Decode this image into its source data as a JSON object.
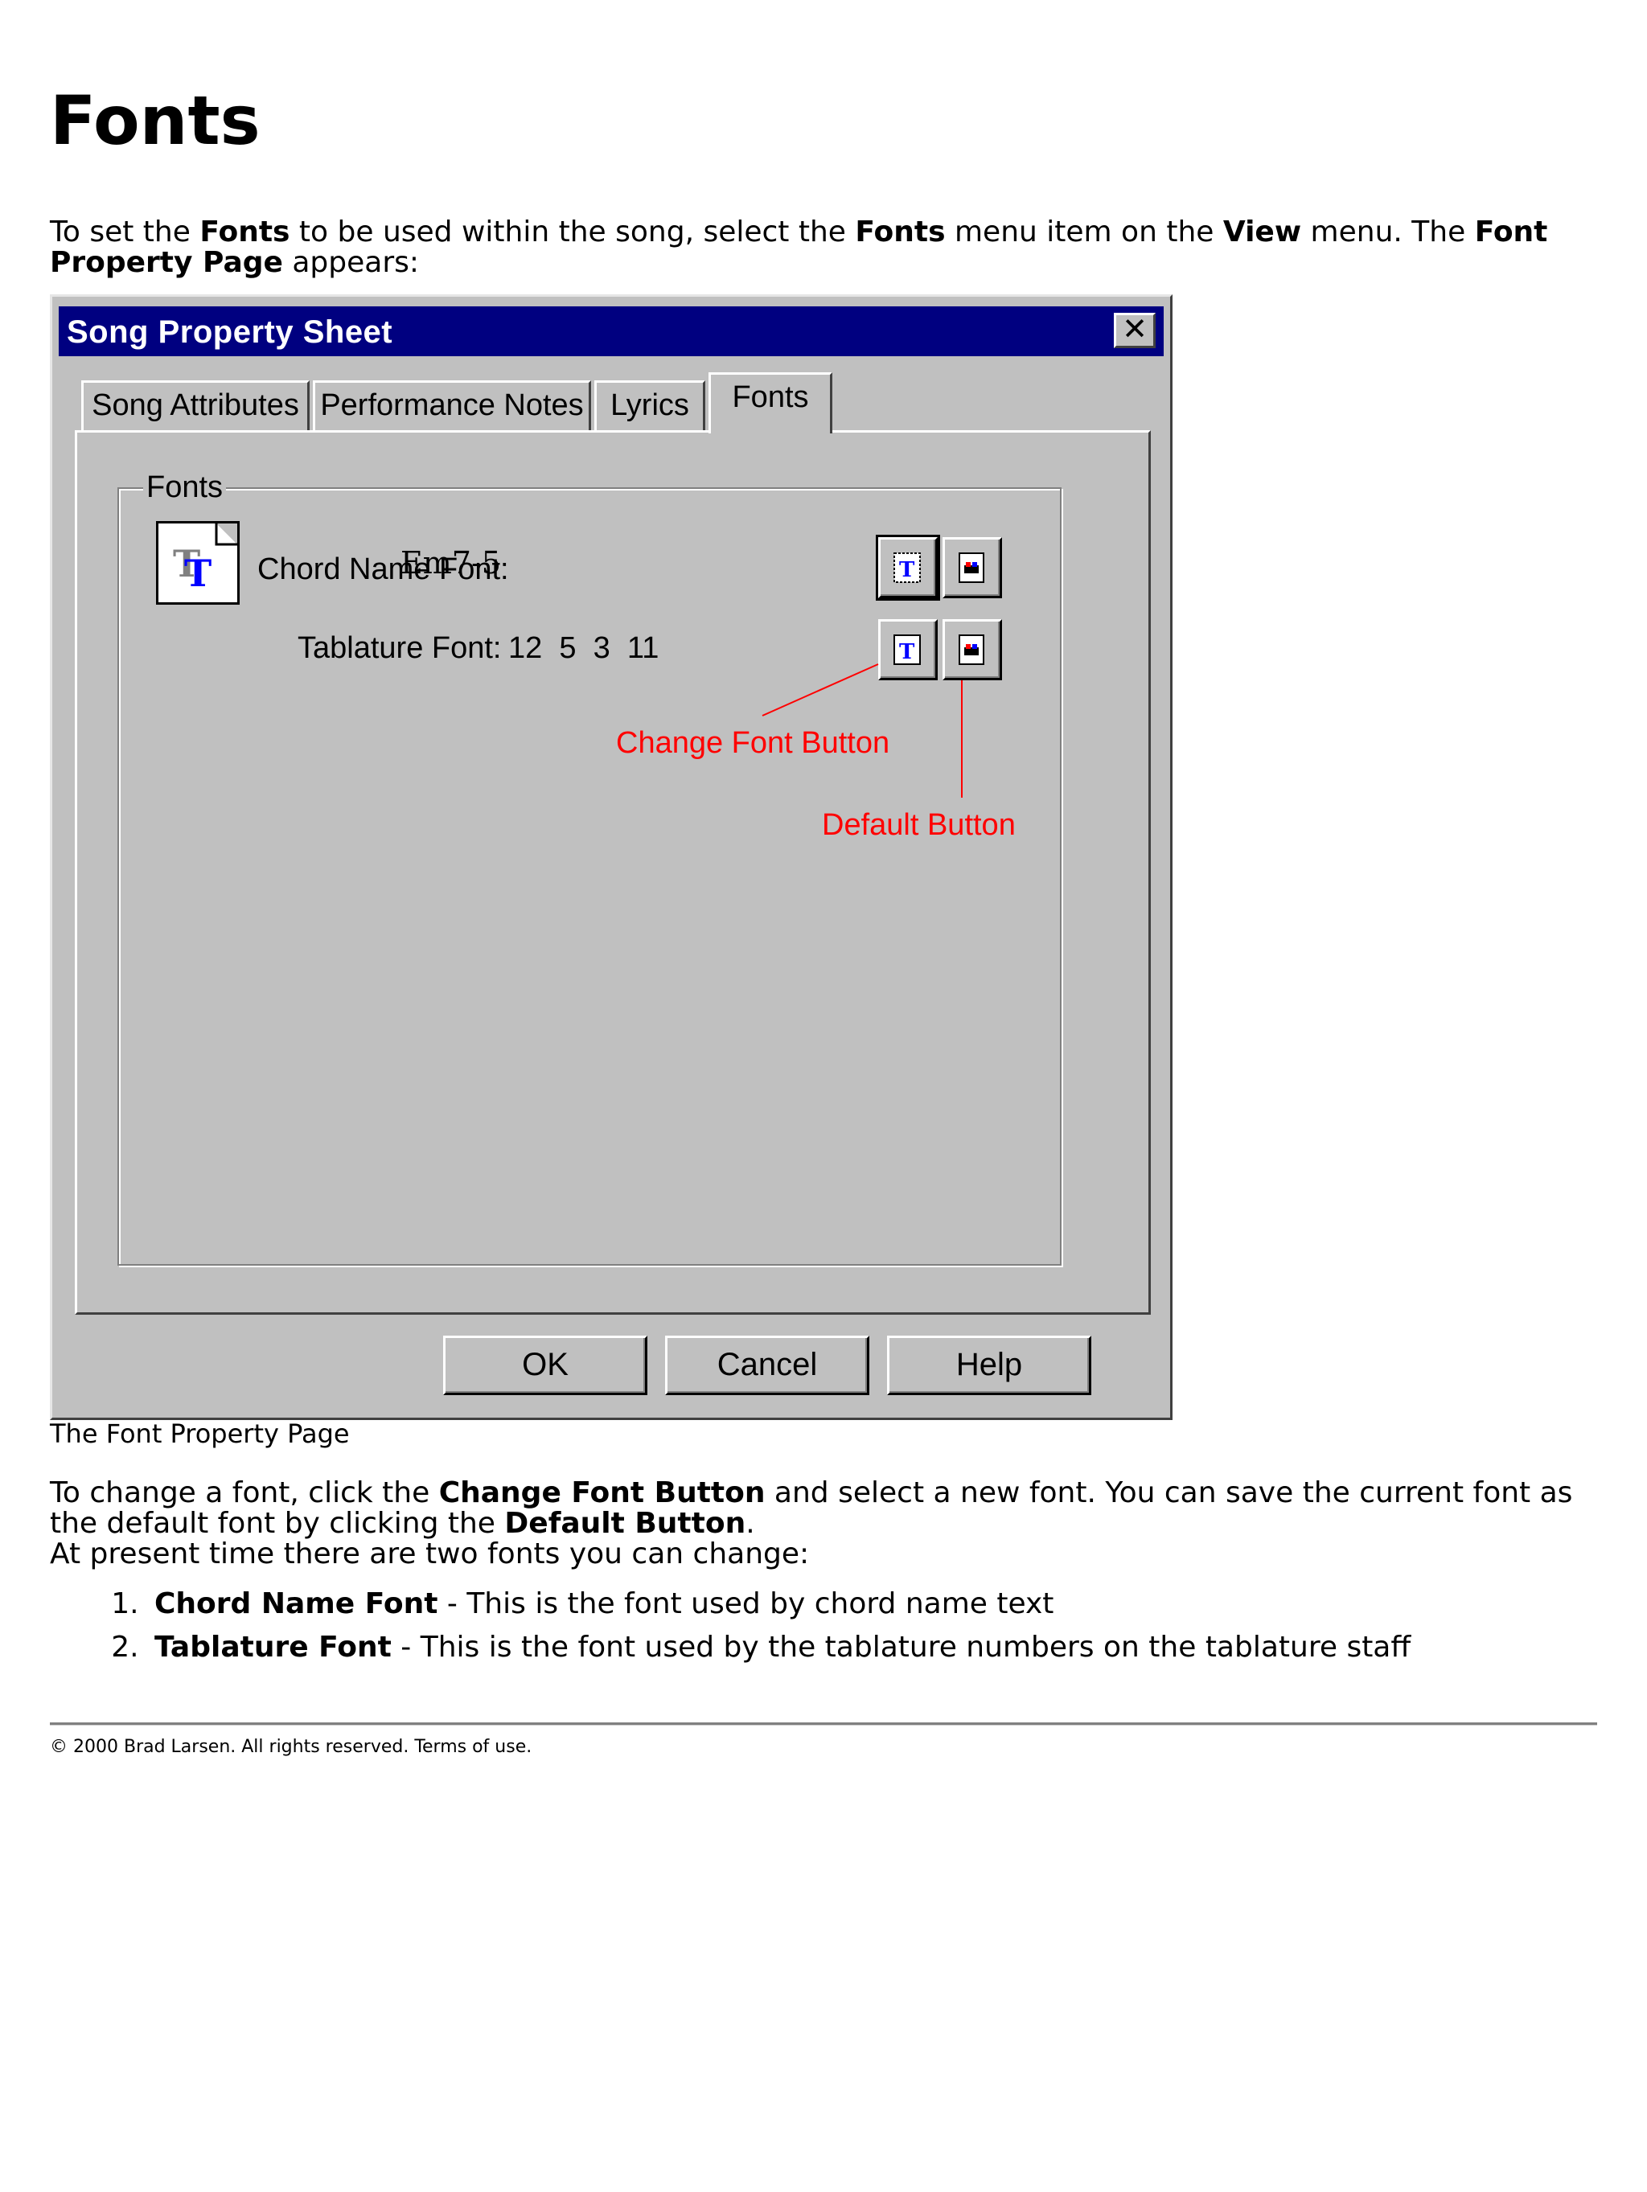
{
  "page": {
    "heading": "Fonts",
    "intro": {
      "t1": "To set the ",
      "b1": "Fonts",
      "t2": " to be used within the song, select the ",
      "b2": "Fonts",
      "t3": " menu item on the ",
      "b3": "View",
      "t4": " menu. The ",
      "b4": "Font Property Page",
      "t5": " appears:"
    },
    "caption": "The Font Property Page",
    "para2": {
      "t1": "To change a font, click the ",
      "b1": "Change Font Button",
      "t2": " and select a new font. You can save the current font as the default font by clicking the ",
      "b2": "Default Button",
      "t3": "."
    },
    "para3": "At present time there are two fonts you can change:",
    "list": [
      {
        "bold": "Chord Name Font",
        "text": " - This is the font used by chord name text"
      },
      {
        "bold": "Tablature Font",
        "text": " - This is the font used by the tablature numbers on the tablature staff"
      }
    ],
    "footer": "© 2000 Brad Larsen. All rights reserved. Terms of use."
  },
  "dialog": {
    "title": "Song Property Sheet",
    "close_glyph": "✕",
    "tabs": [
      "Song Attributes",
      "Performance Notes",
      "Lyrics",
      "Fonts"
    ],
    "active_tab": "Fonts",
    "group_label": "Fonts",
    "chord_label": "Chord Name Font:",
    "chord_sample": "Em7-5",
    "tab_label": "Tablature Font:",
    "tab_sample": "12  5  3  11",
    "annotation_change": "Change Font Button",
    "annotation_default": "Default Button",
    "buttons": {
      "ok": "OK",
      "cancel": "Cancel",
      "help": "Help"
    },
    "annotation_color": "#ff0000",
    "title_bar_color": "#000080"
  }
}
